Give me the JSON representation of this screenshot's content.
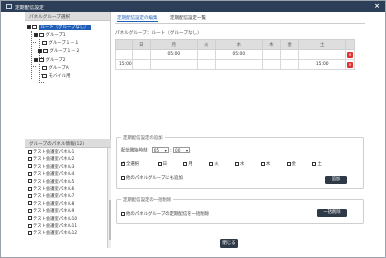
{
  "window": {
    "title": "定期配信設定",
    "close": "×"
  },
  "left": {
    "group_header": "パネルグループ選択",
    "tree": {
      "root": "ルート（グループなし）",
      "group1": "グループ1",
      "group1_1": "グループ１－１",
      "group1_2": "グループ１－２",
      "group2": "グループ2",
      "groupA": "グループA",
      "mobile": "モバイル用"
    },
    "list_header": "グループのパネル情報(12)",
    "panels": [
      "テスト会議室パネル1",
      "テスト会議室パネル2",
      "テスト会議室パネル3",
      "テスト会議室パネル4",
      "テスト会議室パネル5",
      "テスト会議室パネル6",
      "テスト会議室パネル7",
      "テスト会議室パネル8",
      "テスト会議室パネル9",
      "テスト会議室パネル10",
      "テスト会議室パネル11",
      "テスト会議室パネル12"
    ]
  },
  "tabs": {
    "edit": "定期配信設定の編集",
    "list": "定期配信設定一覧"
  },
  "panel_title": "パネルグループ：ルート（グループなし）",
  "calendar": {
    "headers": [
      "日",
      "月",
      "火",
      "水",
      "木",
      "金",
      "土"
    ],
    "rows": [
      {
        "time": "",
        "cells": [
          "",
          "05:00",
          "",
          "05:00",
          "",
          "",
          ""
        ]
      },
      {
        "time": "15:00",
        "cells": [
          "",
          "",
          "",
          "",
          "",
          "",
          "15:00"
        ]
      }
    ],
    "delete_icon": "trash-icon"
  },
  "add_section": {
    "title": "定期配信設定の追加",
    "time_label": "配信開始時刻",
    "hour": "05",
    "minute": "00",
    "days": [
      "全選択",
      "日",
      "月",
      "火",
      "水",
      "木",
      "金",
      "土"
    ],
    "apply_all_label": "他のパネルグループにも追加",
    "add_button": "追加"
  },
  "bulk_section": {
    "title": "定期配信設定の一括削除",
    "label": "他のパネルグループの定期配信を一括削除",
    "button": "一括削除"
  },
  "ok_button": "閉じる",
  "colors": {
    "titlebar": "#2c3e58",
    "selected": "#1f5fb8",
    "delete": "#dd3333",
    "button": "#2f3a48"
  }
}
